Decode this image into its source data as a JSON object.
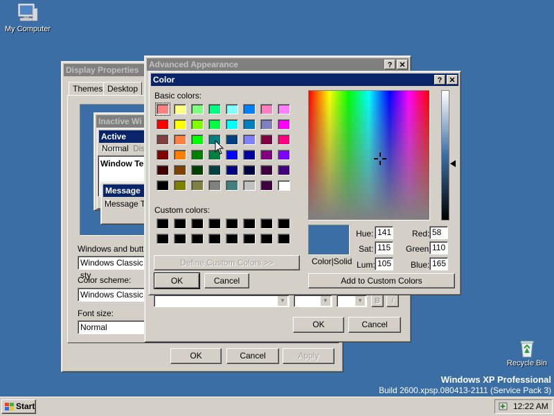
{
  "desktop": {
    "icons": {
      "my_computer": "My Computer",
      "recycle_bin": "Recycle Bin"
    },
    "watermark": {
      "line1": "Windows XP Professional",
      "line2": "Build 2600.xpsp.080413-2111 (Service Pack 3)"
    },
    "background": "#3a6ea5"
  },
  "display_properties": {
    "title": "Display Properties",
    "tabs": [
      "Themes",
      "Desktop"
    ],
    "preview": {
      "inactive_window": "Inactive Wi",
      "active_window": "Active Wind",
      "menu_normal": "Normal",
      "menu_disabled": "Dis",
      "window_text": "Window Te",
      "message_box": "Message B",
      "message_text": "Message Te"
    },
    "windows_and_buttons_label": "Windows and buttor",
    "windows_and_buttons_value": "Windows Classic sty",
    "color_scheme_label": "Color scheme:",
    "color_scheme_value": "Windows Classic",
    "font_size_label": "Font size:",
    "font_size_value": "Normal",
    "buttons": {
      "ok": "OK",
      "cancel": "Cancel",
      "apply": "Apply"
    }
  },
  "advanced_appearance": {
    "title": "Advanced Appearance",
    "buttons": {
      "ok": "OK",
      "cancel": "Cancel"
    },
    "bold_label": "B",
    "italic_label": "I"
  },
  "color_dialog": {
    "title": "Color",
    "basic_colors_label": "Basic colors:",
    "custom_colors_label": "Custom colors:",
    "basic_colors": [
      [
        "#ff8080",
        "#ffff80",
        "#80ff80",
        "#00ff80",
        "#80ffff",
        "#0080ff",
        "#ff80c0",
        "#ff80ff"
      ],
      [
        "#ff0000",
        "#ffff00",
        "#80ff00",
        "#00ff40",
        "#00ffff",
        "#0080c0",
        "#8080c0",
        "#ff00ff"
      ],
      [
        "#804040",
        "#ff8040",
        "#00ff00",
        "#008080",
        "#004080",
        "#8080ff",
        "#800040",
        "#ff0080"
      ],
      [
        "#800000",
        "#ff8000",
        "#008000",
        "#008040",
        "#0000ff",
        "#0000a0",
        "#800080",
        "#8000ff"
      ],
      [
        "#400000",
        "#804000",
        "#004000",
        "#004040",
        "#000080",
        "#000040",
        "#400040",
        "#400080"
      ],
      [
        "#000000",
        "#808000",
        "#808040",
        "#808080",
        "#408080",
        "#c0c0c0",
        "#400040",
        "#ffffff"
      ]
    ],
    "custom_colors": [
      [
        "#000000",
        "#000000",
        "#000000",
        "#000000",
        "#000000",
        "#000000",
        "#000000",
        "#000000"
      ],
      [
        "#000000",
        "#000000",
        "#000000",
        "#000000",
        "#000000",
        "#000000",
        "#000000",
        "#000000"
      ]
    ],
    "selected_basic": {
      "row": 0,
      "col": 0
    },
    "define_custom_label": "Define Custom Colors >>",
    "ok_label": "OK",
    "cancel_label": "Cancel",
    "color_solid_label": "Color|Solid",
    "preview_color": "#3a6ea5",
    "hue_label": "Hue:",
    "hue": "141",
    "sat_label": "Sat:",
    "sat": "115",
    "lum_label": "Lum:",
    "lum": "105",
    "red_label": "Red:",
    "red": "58",
    "green_label": "Green:",
    "green": "110",
    "blue_label": "Blue:",
    "blue": "165",
    "add_custom_label": "Add to Custom Colors"
  },
  "taskbar": {
    "start_label": "Start",
    "clock": "12:22 AM"
  }
}
